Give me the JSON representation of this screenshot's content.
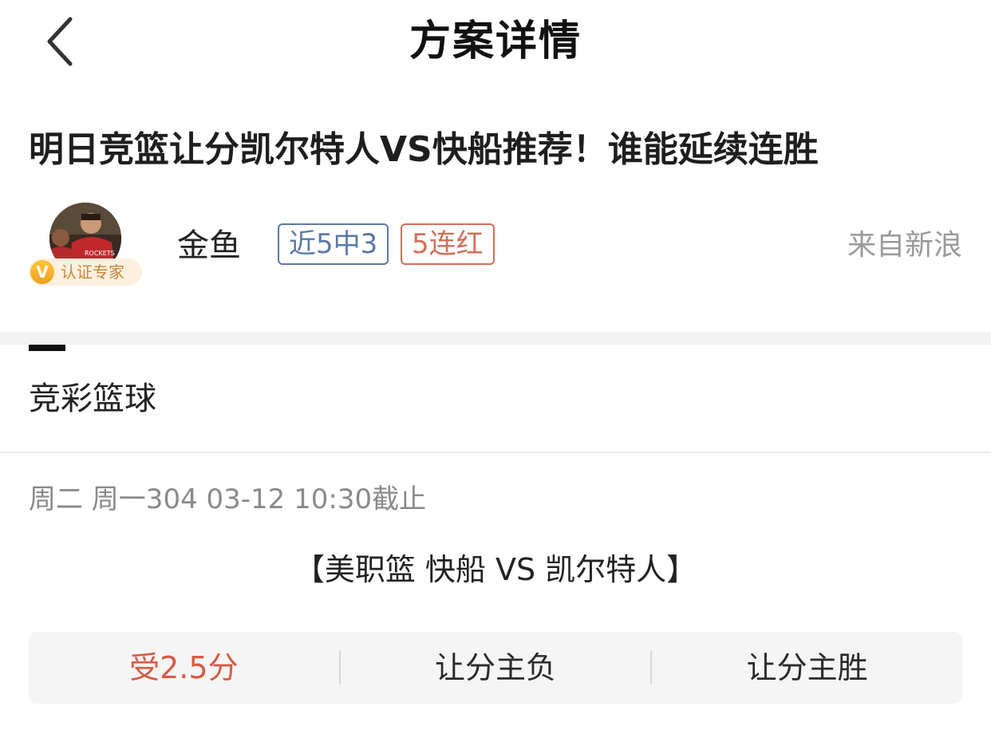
{
  "header": {
    "back_icon": "chevron-left-icon",
    "title": "方案详情"
  },
  "article": {
    "title": "明日竞篮让分凯尔特人VS快船推荐！谁能延续连胜"
  },
  "author": {
    "name": "金鱼",
    "badge_icon": "V",
    "badge_label": "认证专家",
    "tags": [
      "近5中3",
      "5连红"
    ],
    "source": "来自新浪"
  },
  "category": {
    "label": "竞彩篮球"
  },
  "match": {
    "meta": "周二 周一304 03-12 10:30截止",
    "title": "【美职篮 快船 VS 凯尔特人】",
    "odds": [
      {
        "label": "受2.5分",
        "highlight": true
      },
      {
        "label": "让分主负",
        "highlight": false
      },
      {
        "label": "让分主胜",
        "highlight": false
      }
    ]
  },
  "colors": {
    "accent_red": "#d65b45",
    "tag_blue": "#5b78a6",
    "badge_gold": "#c8883a"
  }
}
